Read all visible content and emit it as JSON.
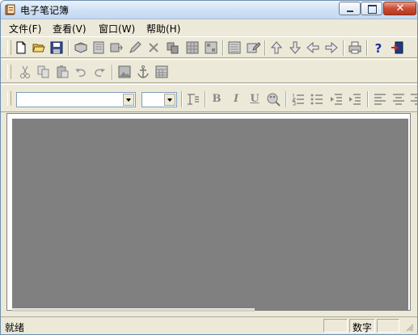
{
  "window": {
    "title": "电子笔记簿"
  },
  "menu": {
    "file": "文件(F)",
    "view": "查看(V)",
    "window": "窗口(W)",
    "help": "帮助(H)"
  },
  "toolbar1": {
    "icons": [
      "new-file-icon",
      "open-folder-icon",
      "save-disk-icon",
      "book-icon",
      "notebook-icon",
      "folder-arrow-icon",
      "pencil-icon",
      "delete-x-icon",
      "copy-pages-icon",
      "page-grid-icon",
      "page-grid-2-icon",
      "list-page-icon",
      "edit-page-icon",
      "arrow-up-icon",
      "arrow-down-icon",
      "arrow-left-icon",
      "arrow-right-icon",
      "printer-icon",
      "help-question-icon",
      "exit-door-icon"
    ]
  },
  "toolbar2": {
    "icons": [
      "cut-icon",
      "copy-icon",
      "paste-icon",
      "undo-icon",
      "redo-icon",
      "insert-image-icon",
      "anchor-icon",
      "calendar-icon"
    ]
  },
  "toolbar3": {
    "font_name": "",
    "font_size": "",
    "bold": "B",
    "italic": "I",
    "underline": "U"
  },
  "statusbar": {
    "status": "就绪",
    "numlock": "数字"
  },
  "colors": {
    "chrome": "#ece9d8",
    "document_area": "#808080",
    "title_gradient_top": "#eaf2fb",
    "close_button": "#c94d33"
  }
}
